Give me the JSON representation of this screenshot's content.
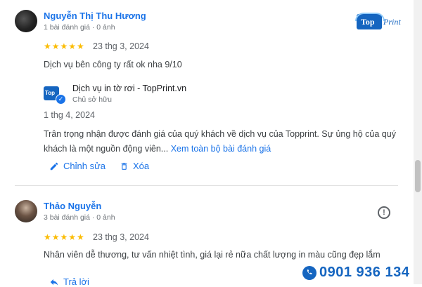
{
  "reviews": [
    {
      "author": "Nguyễn Thị Thu Hương",
      "meta": "1 bài đánh giá · 0 ảnh",
      "stars": "★★★★★",
      "date": "23 thg 3, 2024",
      "text": "Dịch vụ bên công ty rất ok nha 9/10",
      "owner_reply": {
        "business_name": "Dịch vụ in tờ rơi - TopPrint.vn",
        "role": "Chủ sở hữu",
        "date": "1 thg 4, 2024",
        "text": "Trân trọng nhận được đánh giá của quý khách về dịch vụ của Topprint. Sự ủng hộ của quý khách là một nguồn động viên...",
        "more_link": "Xem toàn bộ bài đánh giá",
        "edit_label": "Chỉnh sửa",
        "delete_label": "Xóa"
      }
    },
    {
      "author": "Thảo Nguyễn",
      "meta": "3 bài đánh giá · 0 ảnh",
      "stars": "★★★★★",
      "date": "23 thg 3, 2024",
      "text": "Nhân viên dễ thương, tư vấn nhiệt tình, giá lại rẻ nữa chất lượng in màu cũng đẹp lắm",
      "reply_label": "Trả lời"
    }
  ],
  "brand_logo": {
    "part1": "Top",
    "part2": "Print"
  },
  "mini_logo": "Top",
  "watermark_phone": "0901 936 134",
  "colors": {
    "accent": "#1a73e8",
    "star": "#fbbc04",
    "brand": "#1565c0"
  }
}
